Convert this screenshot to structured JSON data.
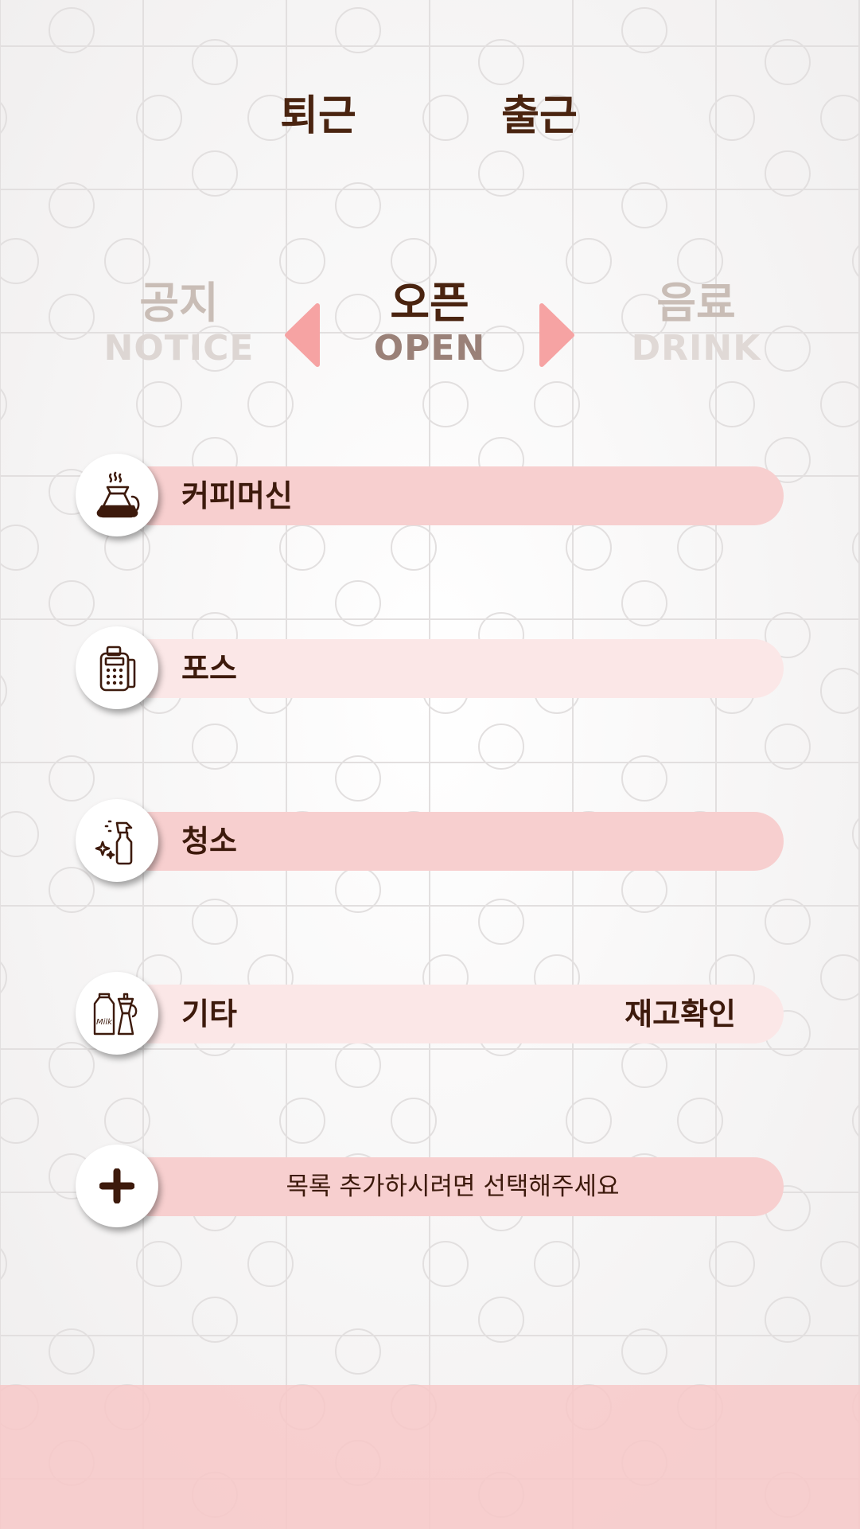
{
  "top_toggle": {
    "leave_label": "퇴근",
    "arrive_label": "출근"
  },
  "categories": {
    "prev": {
      "label_kr": "공지",
      "label_en": "NOTICE"
    },
    "current": {
      "label_kr": "오픈",
      "label_en": "OPEN"
    },
    "next": {
      "label_kr": "음료",
      "label_en": "DRINK"
    }
  },
  "checklist": {
    "items": [
      {
        "label": "커피머신",
        "icon": "coffee-pot-icon"
      },
      {
        "label": "포스",
        "icon": "pos-terminal-icon"
      },
      {
        "label": "청소",
        "icon": "spray-bottle-icon"
      },
      {
        "label": "기타",
        "icon": "milk-moka-pot-icon",
        "action_label": "재고확인"
      }
    ],
    "add_prompt": "목록 추가하시려면 선택해주세요",
    "add_icon": "plus-icon"
  },
  "colors": {
    "accent": "#f6a3a3",
    "text_dark": "#4a2410",
    "pill_strong": "#f7cfcf",
    "pill_light": "#fbe7e7"
  }
}
